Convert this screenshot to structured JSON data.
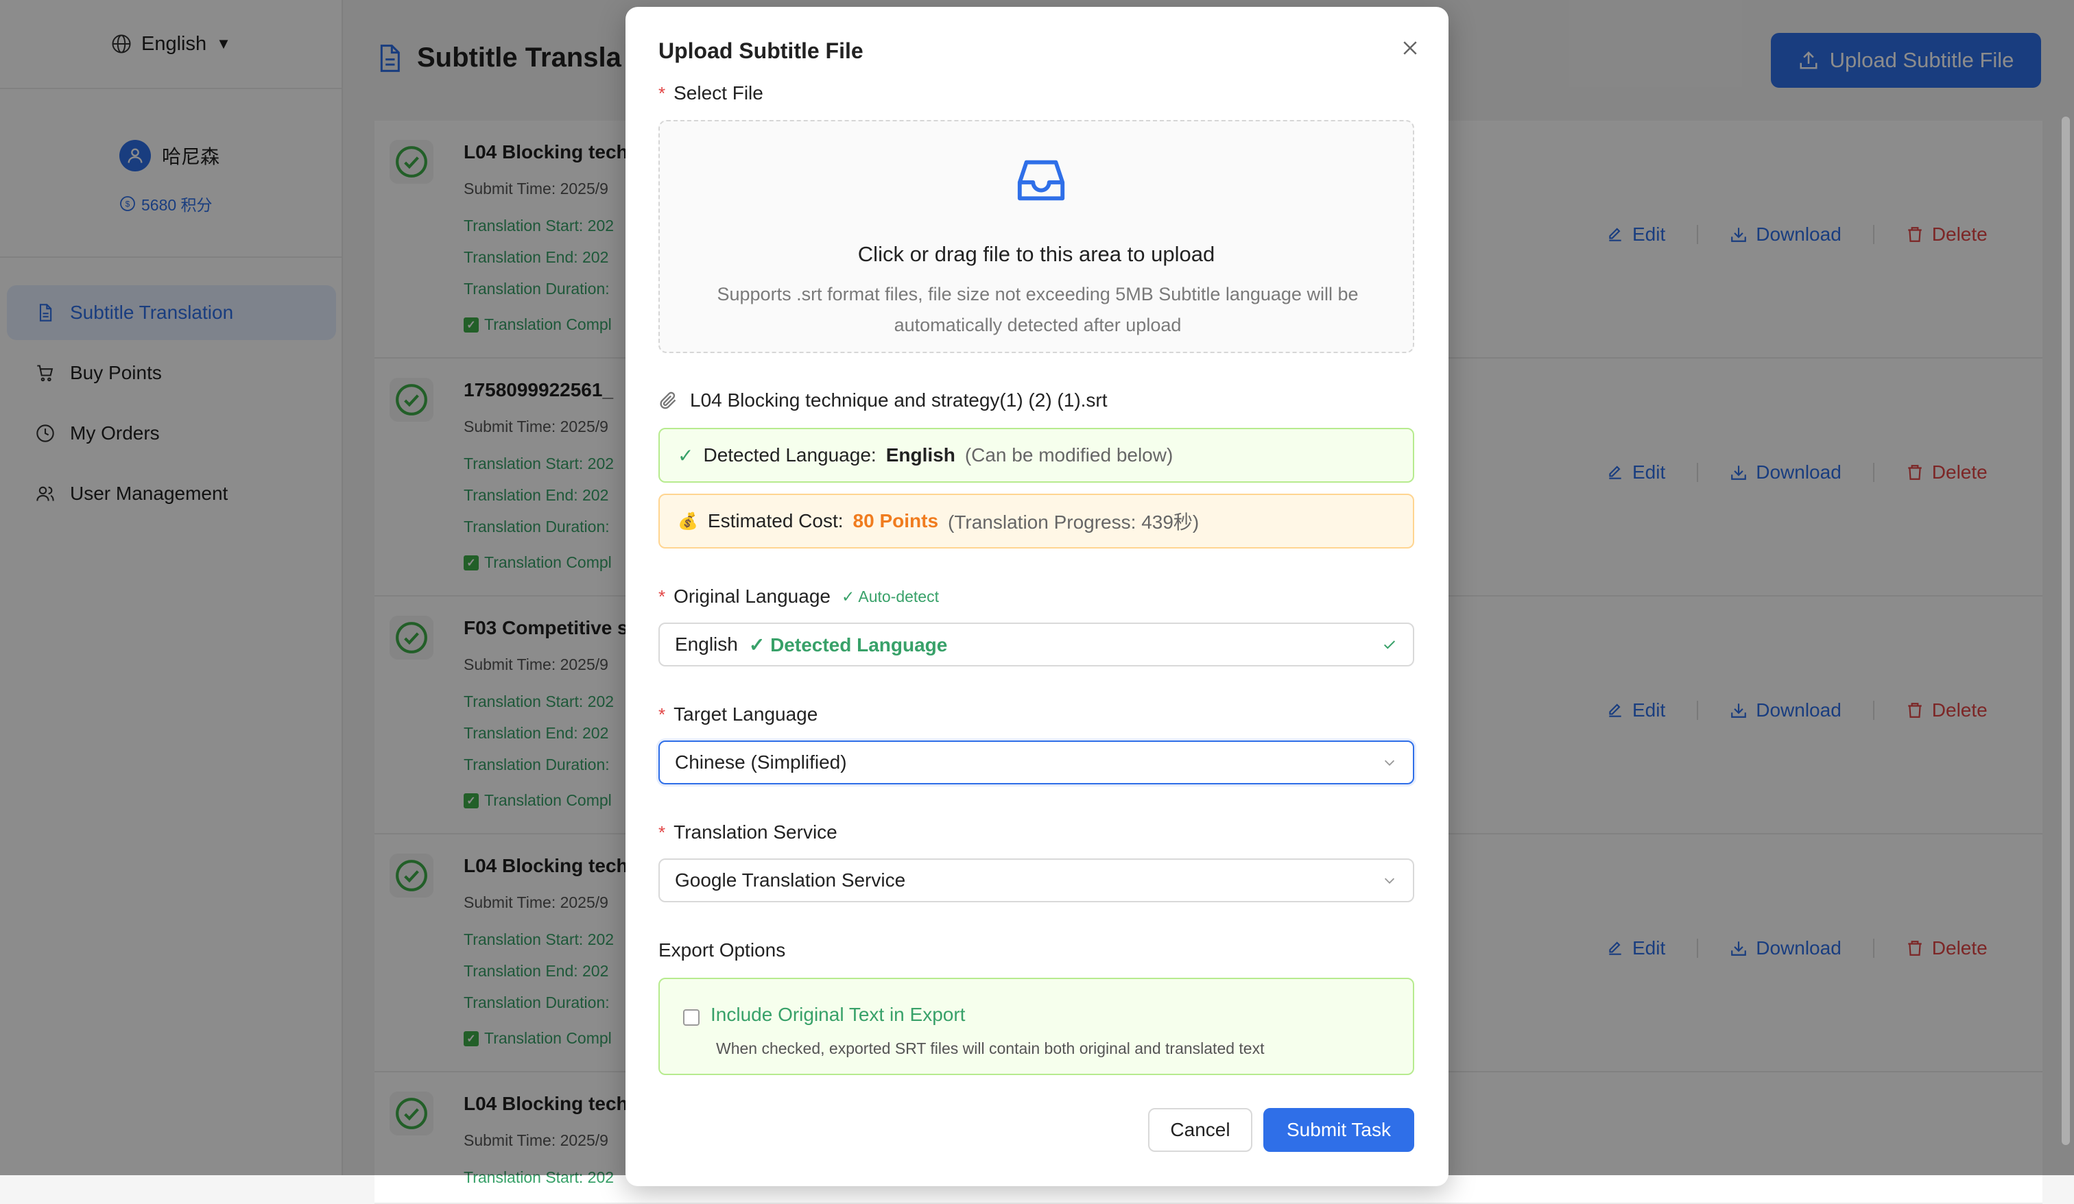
{
  "sidebar": {
    "language": "English",
    "user_name": "哈尼森",
    "points": "5680 积分",
    "nav": [
      {
        "label": "Subtitle Translation"
      },
      {
        "label": "Buy Points"
      },
      {
        "label": "My Orders"
      },
      {
        "label": "User Management"
      }
    ]
  },
  "main": {
    "title": "Subtitle Transla",
    "upload_button": "Upload Subtitle File",
    "actions": {
      "edit": "Edit",
      "download": "Download",
      "delete": "Delete"
    },
    "tasks": [
      {
        "name": "L04 Blocking tech",
        "submit": "Submit Time: 2025/9",
        "start": "Translation Start: 202",
        "end": "Translation End: 202",
        "duration": "Translation Duration:",
        "status": "Translation Compl"
      },
      {
        "name": "1758099922561_",
        "submit": "Submit Time: 2025/9",
        "start": "Translation Start: 202",
        "end": "Translation End: 202",
        "duration": "Translation Duration:",
        "status": "Translation Compl"
      },
      {
        "name": "F03 Competitive s",
        "submit": "Submit Time: 2025/9",
        "start": "Translation Start: 202",
        "end": "Translation End: 202",
        "duration": "Translation Duration:",
        "status": "Translation Compl"
      },
      {
        "name": "L04 Blocking tech",
        "submit": "Submit Time: 2025/9",
        "start": "Translation Start: 202",
        "end": "Translation End: 202",
        "duration": "Translation Duration:",
        "status": "Translation Compl"
      },
      {
        "name": "L04 Blocking tech",
        "submit": "Submit Time: 2025/9",
        "start": "Translation Start: 202"
      }
    ]
  },
  "modal": {
    "title": "Upload Subtitle File",
    "select_file_label": "Select File",
    "dropzone_title": "Click or drag file to this area to upload",
    "dropzone_hint": "Supports .srt format files, file size not exceeding 5MB Subtitle language will be automatically detected after upload",
    "file_name": "L04 Blocking technique and strategy(1) (2) (1).srt",
    "detected_prefix": "Detected Language:",
    "detected_language": "English",
    "detected_note": "(Can be modified below)",
    "cost_icon": "💰",
    "cost_prefix": "Estimated Cost:",
    "cost_points": "80 Points",
    "cost_note": "(Translation Progress: 439秒)",
    "original_language_label": "Original Language",
    "auto_detect": "✓ Auto-detect",
    "original_language_value": "English",
    "original_language_tag": "✓ Detected Language",
    "target_language_label": "Target Language",
    "target_language_value": "Chinese (Simplified)",
    "service_label": "Translation Service",
    "service_value": "Google Translation Service",
    "export_label": "Export Options",
    "include_original_label": "Include Original Text in Export",
    "include_original_checked": false,
    "include_original_desc": "When checked, exported SRT files will contain both original and translated text",
    "cancel": "Cancel",
    "submit": "Submit Task"
  },
  "colors": {
    "primary": "#2f6fe8",
    "success": "#38a169",
    "danger": "#e24545",
    "warning": "#f07c1f"
  }
}
